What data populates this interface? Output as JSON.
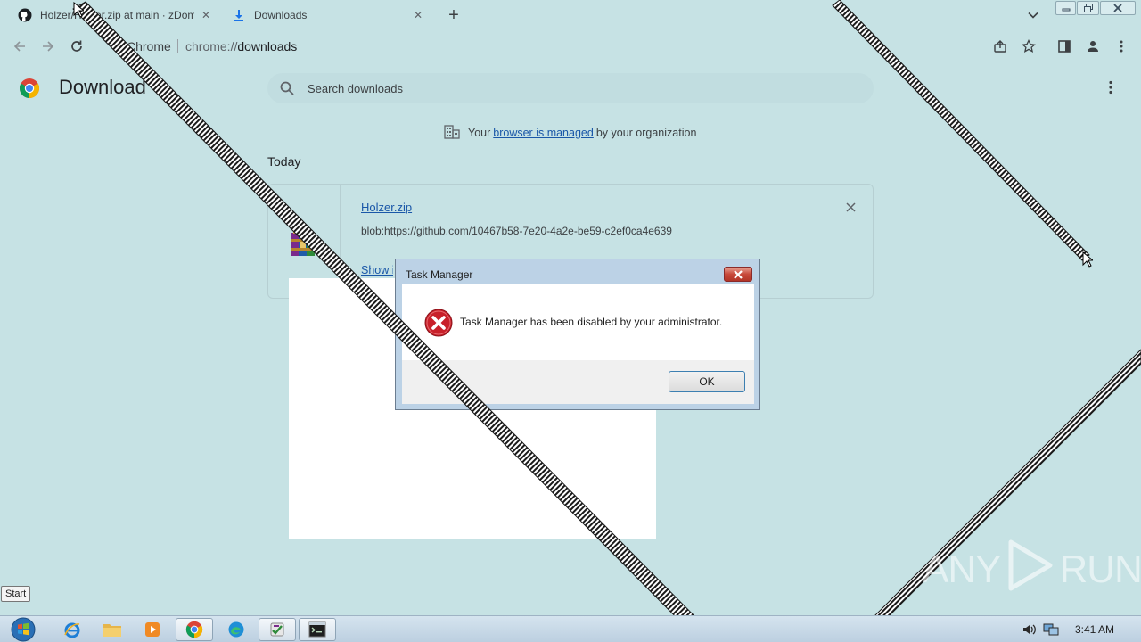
{
  "tabs": [
    {
      "label": "Holzer/Holzer.zip at main · zDom",
      "icon": "github-icon",
      "close": "✕"
    },
    {
      "label": "Downloads",
      "icon": "download-icon",
      "close": "✕"
    }
  ],
  "new_tab": "+",
  "omnibox": {
    "site_label": "Chrome",
    "url_scheme": "chrome://",
    "url_host": "downloads"
  },
  "page": {
    "title": "Download",
    "search_placeholder": "Search downloads",
    "managed": {
      "prefix": "Your",
      "link": "browser is managed",
      "suffix": "by your organization"
    },
    "section": "Today",
    "download": {
      "filename": "Holzer.zip",
      "url": "blob:https://github.com/10467b58-7e20-4a2e-be59-c2ef0ca4e639",
      "action": "Show in folder",
      "icon": "winrar-archive-icon"
    }
  },
  "dialog": {
    "title": "Task Manager",
    "message": "Task Manager has been disabled by your administrator.",
    "ok_label": "OK",
    "icon": "error-icon"
  },
  "start_tooltip": "Start",
  "watermark": {
    "left": "ANY",
    "right": "RUN"
  },
  "taskbar": {
    "apps": [
      "internet-explorer-icon",
      "file-explorer-icon",
      "media-player-icon",
      "chrome-icon",
      "edge-icon",
      "app-icon",
      "terminal-icon"
    ],
    "clock": "3:41 AM"
  },
  "colors": {
    "page_background": "#c6e2e4",
    "link": "#1a57a8",
    "dialog_frame": "#bcd2e6",
    "error_red": "#c8202a"
  }
}
